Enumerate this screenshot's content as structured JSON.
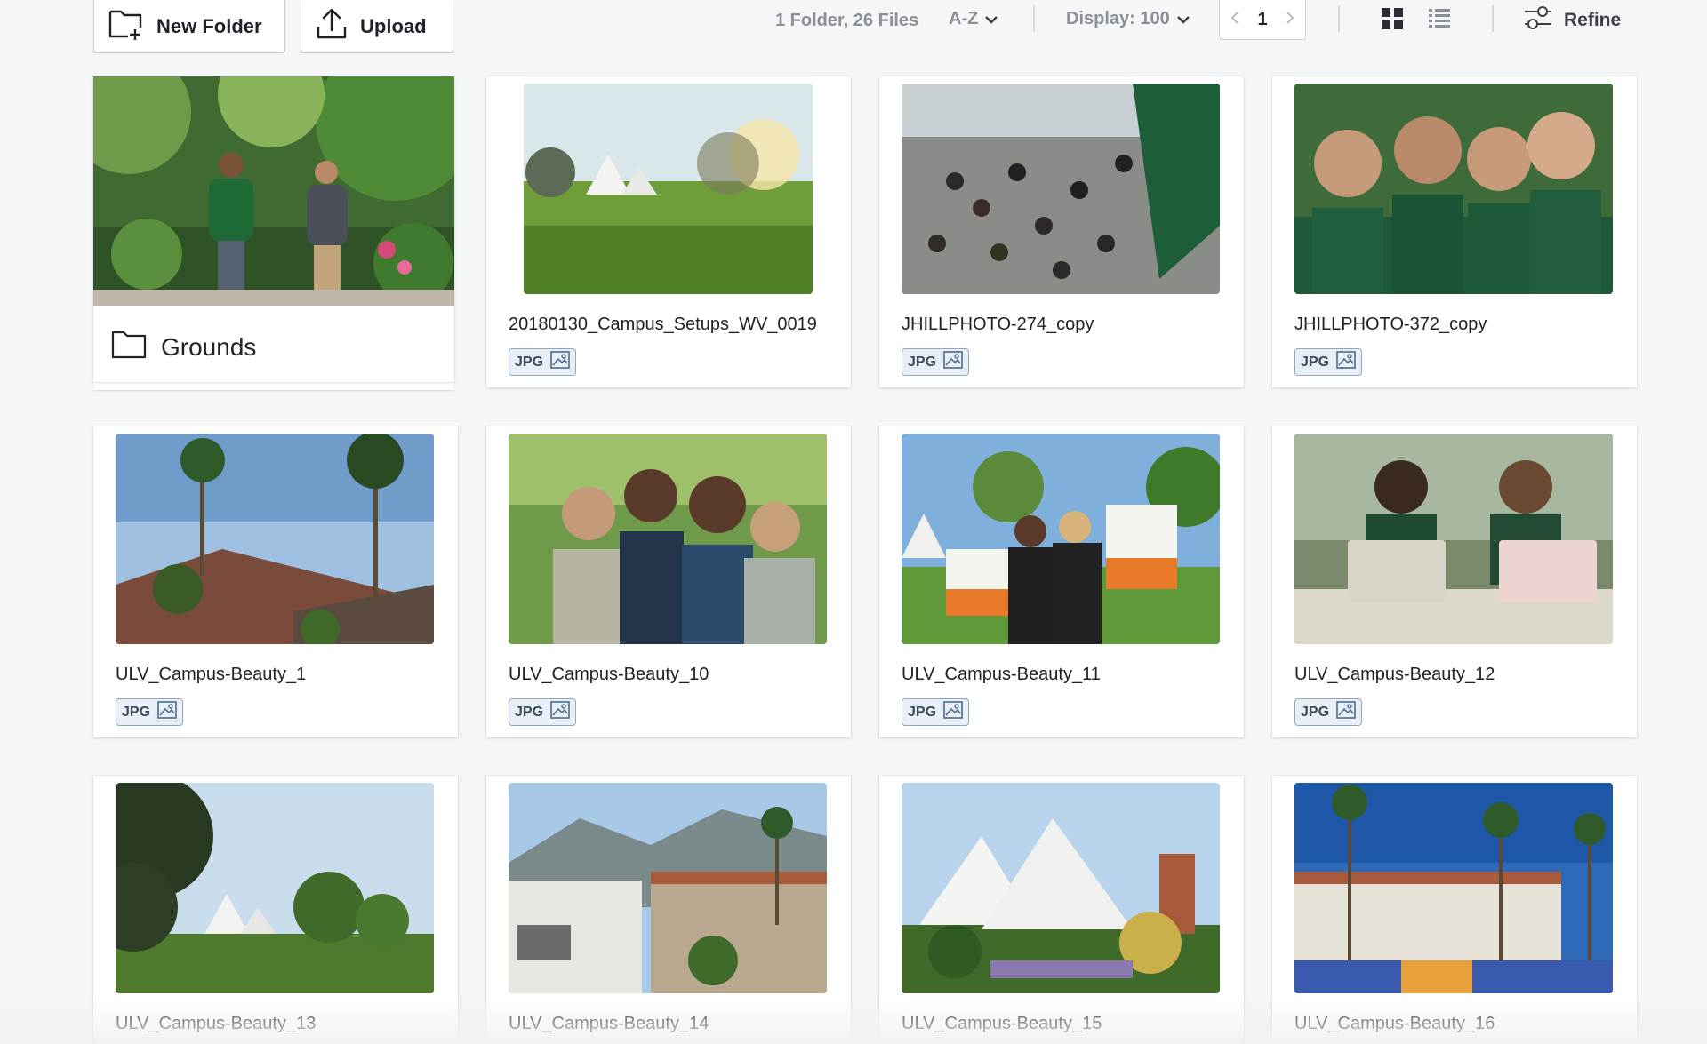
{
  "toolbar": {
    "new_folder_label": "New Folder",
    "upload_label": "Upload",
    "file_count": "1 Folder, 26 Files",
    "sort_value": "A-Z",
    "display_value": "Display: 100",
    "current_page": "1",
    "refine_label": "Refine",
    "icons": {
      "new_folder": "folder-plus-icon",
      "upload": "upload-icon",
      "sort": "chevron-down-icon",
      "display": "chevron-down-icon",
      "prev": "chevron-left-icon",
      "next": "chevron-right-icon",
      "grid_view": "grid-view-icon",
      "list_view": "list-view-icon",
      "refine": "sliders-icon"
    }
  },
  "folder": {
    "name": "Grounds",
    "icon": "folder-icon"
  },
  "files": [
    {
      "name": "20180130_Campus_Setups_WV_0019",
      "type": "JPG"
    },
    {
      "name": "JHILLPHOTO-274_copy",
      "type": "JPG"
    },
    {
      "name": "JHILLPHOTO-372_copy",
      "type": "JPG"
    },
    {
      "name": "ULV_Campus-Beauty_1",
      "type": "JPG"
    },
    {
      "name": "ULV_Campus-Beauty_10",
      "type": "JPG"
    },
    {
      "name": "ULV_Campus-Beauty_11",
      "type": "JPG"
    },
    {
      "name": "ULV_Campus-Beauty_12",
      "type": "JPG"
    },
    {
      "name": "ULV_Campus-Beauty_13",
      "type": "JPG"
    },
    {
      "name": "ULV_Campus-Beauty_14",
      "type": "JPG"
    },
    {
      "name": "ULV_Campus-Beauty_15",
      "type": "JPG"
    },
    {
      "name": "ULV_Campus-Beauty_16",
      "type": "JPG"
    }
  ],
  "colors": {
    "background": "#f5f6f8",
    "card": "#ffffff",
    "badge_border": "#8ea6bf",
    "badge_fill": "#e9eff6",
    "muted_text": "#8a9099"
  }
}
